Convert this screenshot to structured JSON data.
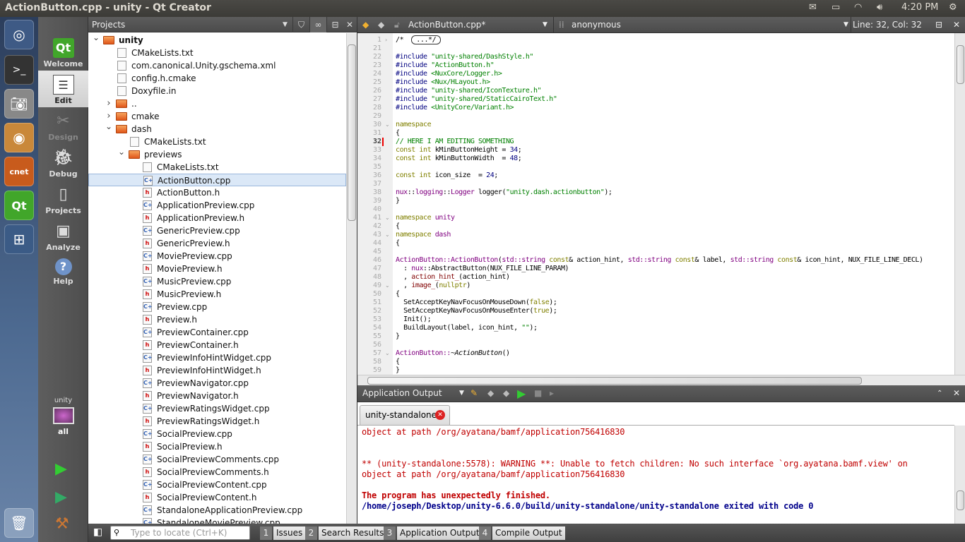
{
  "window": {
    "title": "ActionButton.cpp - unity - Qt Creator",
    "clock": "4:20 PM"
  },
  "tray_icons": [
    "mail-icon",
    "battery-icon",
    "wifi-icon",
    "volume-icon",
    "gear-icon"
  ],
  "launcher": [
    "ubuntu-dash-icon",
    "terminal-icon",
    "camera-icon",
    "chrome-icon",
    "cnet-icon",
    "qt-creator-icon",
    "workspace-switcher-icon",
    "trash-icon"
  ],
  "modes": [
    {
      "label": "Welcome",
      "icon": "qt-logo-icon",
      "state": "normal"
    },
    {
      "label": "Edit",
      "icon": "edit-document-icon",
      "state": "selected"
    },
    {
      "label": "Design",
      "icon": "design-icon",
      "state": "disabled"
    },
    {
      "label": "Debug",
      "icon": "debug-icon",
      "state": "normal"
    },
    {
      "label": "Projects",
      "icon": "projects-icon",
      "state": "normal"
    },
    {
      "label": "Analyze",
      "icon": "analyze-icon",
      "state": "normal"
    },
    {
      "label": "Help",
      "icon": "help-icon",
      "state": "normal"
    }
  ],
  "kit": {
    "project": "unity",
    "config": "all"
  },
  "projects": {
    "title": "Projects",
    "tree": [
      {
        "name": "unity",
        "type": "folder",
        "depth": 0,
        "arrow": "open",
        "bold": true
      },
      {
        "name": "CMakeLists.txt",
        "type": "file",
        "depth": 1
      },
      {
        "name": "com.canonical.Unity.gschema.xml",
        "type": "file",
        "depth": 1
      },
      {
        "name": "config.h.cmake",
        "type": "file",
        "depth": 1
      },
      {
        "name": "Doxyfile.in",
        "type": "file",
        "depth": 1
      },
      {
        "name": "..",
        "type": "folder",
        "depth": 1,
        "arrow": "closed"
      },
      {
        "name": "cmake",
        "type": "folder",
        "depth": 1,
        "arrow": "closed"
      },
      {
        "name": "dash",
        "type": "folder",
        "depth": 1,
        "arrow": "open"
      },
      {
        "name": "CMakeLists.txt",
        "type": "file",
        "depth": 2
      },
      {
        "name": "previews",
        "type": "folder",
        "depth": 2,
        "arrow": "open"
      },
      {
        "name": "CMakeLists.txt",
        "type": "file",
        "depth": 3
      },
      {
        "name": "ActionButton.cpp",
        "type": "cpp",
        "depth": 3,
        "selected": true
      },
      {
        "name": "ActionButton.h",
        "type": "h",
        "depth": 3
      },
      {
        "name": "ApplicationPreview.cpp",
        "type": "cpp",
        "depth": 3
      },
      {
        "name": "ApplicationPreview.h",
        "type": "h",
        "depth": 3
      },
      {
        "name": "GenericPreview.cpp",
        "type": "cpp",
        "depth": 3
      },
      {
        "name": "GenericPreview.h",
        "type": "h",
        "depth": 3
      },
      {
        "name": "MoviePreview.cpp",
        "type": "cpp",
        "depth": 3
      },
      {
        "name": "MoviePreview.h",
        "type": "h",
        "depth": 3
      },
      {
        "name": "MusicPreview.cpp",
        "type": "cpp",
        "depth": 3
      },
      {
        "name": "MusicPreview.h",
        "type": "h",
        "depth": 3
      },
      {
        "name": "Preview.cpp",
        "type": "cpp",
        "depth": 3
      },
      {
        "name": "Preview.h",
        "type": "h",
        "depth": 3
      },
      {
        "name": "PreviewContainer.cpp",
        "type": "cpp",
        "depth": 3
      },
      {
        "name": "PreviewContainer.h",
        "type": "h",
        "depth": 3
      },
      {
        "name": "PreviewInfoHintWidget.cpp",
        "type": "cpp",
        "depth": 3
      },
      {
        "name": "PreviewInfoHintWidget.h",
        "type": "h",
        "depth": 3
      },
      {
        "name": "PreviewNavigator.cpp",
        "type": "cpp",
        "depth": 3
      },
      {
        "name": "PreviewNavigator.h",
        "type": "h",
        "depth": 3
      },
      {
        "name": "PreviewRatingsWidget.cpp",
        "type": "cpp",
        "depth": 3
      },
      {
        "name": "PreviewRatingsWidget.h",
        "type": "h",
        "depth": 3
      },
      {
        "name": "SocialPreview.cpp",
        "type": "cpp",
        "depth": 3
      },
      {
        "name": "SocialPreview.h",
        "type": "h",
        "depth": 3
      },
      {
        "name": "SocialPreviewComments.cpp",
        "type": "cpp",
        "depth": 3
      },
      {
        "name": "SocialPreviewComments.h",
        "type": "h",
        "depth": 3
      },
      {
        "name": "SocialPreviewContent.cpp",
        "type": "cpp",
        "depth": 3
      },
      {
        "name": "SocialPreviewContent.h",
        "type": "h",
        "depth": 3
      },
      {
        "name": "StandaloneApplicationPreview.cpp",
        "type": "cpp",
        "depth": 3
      },
      {
        "name": "StandaloneMoviePreview.cpp",
        "type": "cpp",
        "depth": 3
      }
    ]
  },
  "editor": {
    "file": "ActionButton.cpp*",
    "symbol": "anonymous",
    "position": "Line: 32, Col: 32",
    "current_line": "32",
    "lines": [
      {
        "n": "1",
        "fold": "closed",
        "t": [
          [
            "/*  ",
            ""
          ],
          [
            "...*/",
            "fbox"
          ]
        ]
      },
      {
        "n": "21",
        "t": []
      },
      {
        "n": "22",
        "t": [
          [
            "#include ",
            "p"
          ],
          [
            "\"unity-shared/DashStyle.h\"",
            "s"
          ]
        ]
      },
      {
        "n": "23",
        "t": [
          [
            "#include ",
            "p"
          ],
          [
            "\"ActionButton.h\"",
            "s"
          ]
        ]
      },
      {
        "n": "24",
        "t": [
          [
            "#include ",
            "p"
          ],
          [
            "<NuxCore/Logger.h>",
            "s"
          ]
        ]
      },
      {
        "n": "25",
        "t": [
          [
            "#include ",
            "p"
          ],
          [
            "<Nux/HLayout.h>",
            "s"
          ]
        ]
      },
      {
        "n": "26",
        "t": [
          [
            "#include ",
            "p"
          ],
          [
            "\"unity-shared/IconTexture.h\"",
            "s"
          ]
        ]
      },
      {
        "n": "27",
        "t": [
          [
            "#include ",
            "p"
          ],
          [
            "\"unity-shared/StaticCairoText.h\"",
            "s"
          ]
        ]
      },
      {
        "n": "28",
        "t": [
          [
            "#include ",
            "p"
          ],
          [
            "<UnityCore/Variant.h>",
            "s"
          ]
        ]
      },
      {
        "n": "29",
        "t": []
      },
      {
        "n": "30",
        "fold": "open",
        "t": [
          [
            "namespace",
            "k"
          ]
        ]
      },
      {
        "n": "31",
        "t": [
          [
            "{",
            ""
          ]
        ]
      },
      {
        "n": "32",
        "t": [
          [
            "// HERE I AM EDITING SOMETHING",
            "c"
          ]
        ]
      },
      {
        "n": "33",
        "t": [
          [
            "const int",
            "k"
          ],
          [
            " kMinButtonHeight = ",
            ""
          ],
          [
            "34",
            "n"
          ],
          [
            ";",
            ""
          ]
        ]
      },
      {
        "n": "34",
        "t": [
          [
            "const int",
            "k"
          ],
          [
            " kMinButtonWidth  = ",
            ""
          ],
          [
            "48",
            "n"
          ],
          [
            ";",
            ""
          ]
        ]
      },
      {
        "n": "35",
        "t": []
      },
      {
        "n": "36",
        "t": [
          [
            "const int",
            "k"
          ],
          [
            " icon_size  = ",
            ""
          ],
          [
            "24",
            "n"
          ],
          [
            ";",
            ""
          ]
        ]
      },
      {
        "n": "37",
        "t": []
      },
      {
        "n": "38",
        "t": [
          [
            "nux",
            "t"
          ],
          [
            "::",
            ""
          ],
          [
            "logging",
            "t"
          ],
          [
            "::",
            ""
          ],
          [
            "Logger",
            "t"
          ],
          [
            " logger(",
            ""
          ],
          [
            "\"unity.dash.actionbutton\"",
            "s"
          ],
          [
            ");",
            ""
          ]
        ]
      },
      {
        "n": "39",
        "t": [
          [
            "}",
            ""
          ]
        ]
      },
      {
        "n": "40",
        "t": []
      },
      {
        "n": "41",
        "fold": "open",
        "t": [
          [
            "namespace",
            "k"
          ],
          [
            " ",
            ""
          ],
          [
            "unity",
            "t"
          ]
        ]
      },
      {
        "n": "42",
        "t": [
          [
            "{",
            ""
          ]
        ]
      },
      {
        "n": "43",
        "fold": "open",
        "t": [
          [
            "namespace",
            "k"
          ],
          [
            " ",
            ""
          ],
          [
            "dash",
            "t"
          ]
        ]
      },
      {
        "n": "44",
        "t": [
          [
            "{",
            ""
          ]
        ]
      },
      {
        "n": "45",
        "t": []
      },
      {
        "n": "46",
        "t": [
          [
            "ActionButton::ActionButton",
            "t"
          ],
          [
            "(",
            ""
          ],
          [
            "std::string",
            "t"
          ],
          [
            " ",
            ""
          ],
          [
            "const",
            "k"
          ],
          [
            "& action_hint, ",
            ""
          ],
          [
            "std::string",
            "t"
          ],
          [
            " ",
            ""
          ],
          [
            "const",
            "k"
          ],
          [
            "& label, ",
            ""
          ],
          [
            "std::string",
            "t"
          ],
          [
            " ",
            ""
          ],
          [
            "const",
            "k"
          ],
          [
            "& icon_hint, NUX_FILE_LINE_DECL)",
            ""
          ]
        ]
      },
      {
        "n": "47",
        "t": [
          [
            "  : ",
            ""
          ],
          [
            "nux",
            "t"
          ],
          [
            "::AbstractButton(NUX_FILE_LINE_PARAM)",
            ""
          ]
        ]
      },
      {
        "n": "48",
        "t": [
          [
            "  , ",
            ""
          ],
          [
            "action_hint_",
            "f"
          ],
          [
            "(action_hint)",
            ""
          ]
        ]
      },
      {
        "n": "49",
        "fold": "open",
        "t": [
          [
            "  , ",
            ""
          ],
          [
            "image_",
            "f"
          ],
          [
            "(",
            ""
          ],
          [
            "nullptr",
            "k"
          ],
          [
            ")",
            ""
          ]
        ]
      },
      {
        "n": "50",
        "t": [
          [
            "{",
            ""
          ]
        ]
      },
      {
        "n": "51",
        "t": [
          [
            "  SetAcceptKeyNavFocusOnMouseDown(",
            ""
          ],
          [
            "false",
            "k"
          ],
          [
            ");",
            ""
          ]
        ]
      },
      {
        "n": "52",
        "t": [
          [
            "  SetAcceptKeyNavFocusOnMouseEnter(",
            ""
          ],
          [
            "true",
            "k"
          ],
          [
            ");",
            ""
          ]
        ]
      },
      {
        "n": "53",
        "t": [
          [
            "  Init();",
            ""
          ]
        ]
      },
      {
        "n": "54",
        "t": [
          [
            "  BuildLayout(label, icon_hint, ",
            ""
          ],
          [
            "\"\"",
            "s"
          ],
          [
            ");",
            ""
          ]
        ]
      },
      {
        "n": "55",
        "t": [
          [
            "}",
            ""
          ]
        ]
      },
      {
        "n": "56",
        "t": []
      },
      {
        "n": "57",
        "fold": "open",
        "t": [
          [
            "ActionButton::",
            "t"
          ],
          [
            "~",
            ""
          ],
          [
            "ActionButton",
            "i"
          ],
          [
            "()",
            ""
          ]
        ]
      },
      {
        "n": "58",
        "t": [
          [
            "{",
            ""
          ]
        ]
      },
      {
        "n": "59",
        "t": [
          [
            "}",
            ""
          ]
        ]
      }
    ]
  },
  "output": {
    "title": "Application Output",
    "tab": "unity-standalone",
    "lines": [
      {
        "text": "object at path /org/ayatana/bamf/application756416830",
        "color": "#c00000",
        "bold": false
      },
      {
        "text": "",
        "color": "#c00000",
        "bold": false
      },
      {
        "text": "",
        "color": "#c00000",
        "bold": false
      },
      {
        "text": "** (unity-standalone:5578): WARNING **: Unable to fetch children: No such interface `org.ayatana.bamf.view' on",
        "color": "#c00000",
        "bold": false
      },
      {
        "text": "object at path /org/ayatana/bamf/application756416830",
        "color": "#c00000",
        "bold": false
      },
      {
        "text": "",
        "color": "#c00000",
        "bold": false
      },
      {
        "text": "The program has unexpectedly finished.",
        "color": "#c00000",
        "bold": true
      },
      {
        "text": "/home/joseph/Desktop/unity-6.6.0/build/unity-standalone/unity-standalone exited with code 0",
        "color": "#00008b",
        "bold": true
      }
    ]
  },
  "bottombar": {
    "locator_placeholder": "Type to locate (Ctrl+K)",
    "panes": [
      {
        "num": "1",
        "label": "Issues"
      },
      {
        "num": "2",
        "label": "Search Results"
      },
      {
        "num": "3",
        "label": "Application Output"
      },
      {
        "num": "4",
        "label": "Compile Output"
      }
    ]
  }
}
